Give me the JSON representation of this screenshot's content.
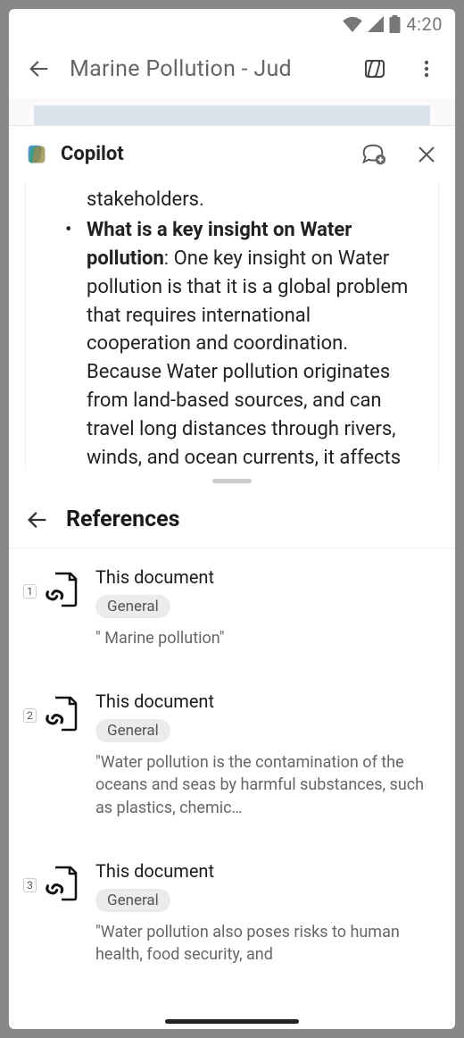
{
  "status_bar": {
    "time": "4:20"
  },
  "app_header": {
    "doc_title": "Marine Pollution - Jud"
  },
  "copilot_header": {
    "title": "Copilot"
  },
  "message": {
    "prev_line": "stakeholders.",
    "bullet_question": "What is a key insight on Water pollution",
    "bullet_answer": ": One key insight on Water pollution is that it is a global problem that requires international cooperation and coordination. Because Water pollution originates from land-based sources, and can travel long distances through rivers, winds, and ocean currents, it affects regions far from its"
  },
  "references": {
    "title": "References",
    "items": [
      {
        "number": "1",
        "title": "This document",
        "tag": "General",
        "snippet": "\" Marine pollution\""
      },
      {
        "number": "2",
        "title": "This document",
        "tag": "General",
        "snippet": "\"Water pollution is the contamination of the oceans and seas by harmful substances, such as plastics, chemic…"
      },
      {
        "number": "3",
        "title": "This document",
        "tag": "General",
        "snippet": "\"Water pollution also poses risks to human health, food security, and"
      }
    ]
  }
}
